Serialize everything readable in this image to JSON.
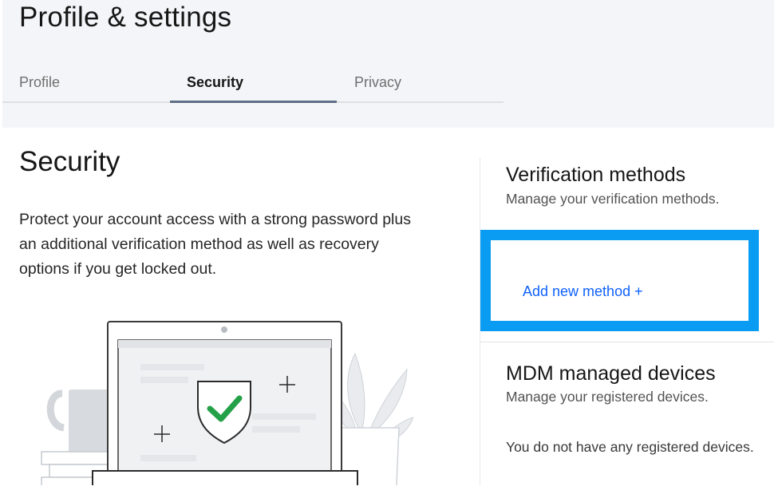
{
  "header": {
    "title": "Profile & settings"
  },
  "tabs": [
    {
      "label": "Profile",
      "active": false
    },
    {
      "label": "Security",
      "active": true
    },
    {
      "label": "Privacy",
      "active": false
    }
  ],
  "security": {
    "title": "Security",
    "description": "Protect your account access with a strong password plus an additional verification method as well as recovery options if you get locked out."
  },
  "verification": {
    "title": "Verification methods",
    "subtitle": "Manage your verification methods.",
    "add_link": "Add new method +"
  },
  "mdm": {
    "title": "MDM managed devices",
    "subtitle": "Manage your registered devices.",
    "empty_message": "You do not have any registered devices."
  },
  "colors": {
    "accent_link": "#0f62fe",
    "highlight_border": "#0a9cf2",
    "check_green": "#24a148",
    "header_bg": "#f4f5f8"
  },
  "icons": {
    "illustration": "laptop-shield-checkmark-illustration"
  }
}
